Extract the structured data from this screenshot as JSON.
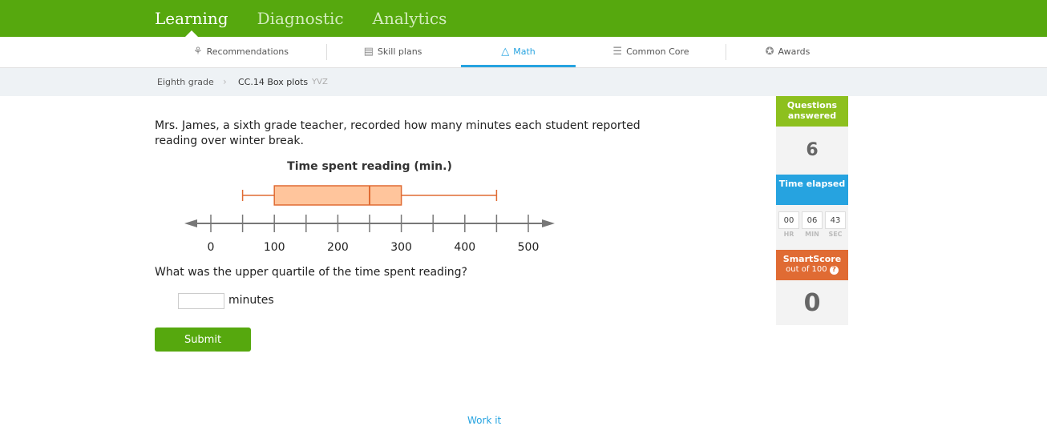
{
  "topnav": [
    "Learning",
    "Diagnostic",
    "Analytics"
  ],
  "subnav": {
    "items": [
      {
        "label": "Recommendations",
        "icon": "recommendations-icon"
      },
      {
        "label": "Skill plans",
        "icon": "skill-plans-icon"
      },
      {
        "label": "Math",
        "icon": "math-icon"
      },
      {
        "label": "Common Core",
        "icon": "common-core-icon"
      },
      {
        "label": "Awards",
        "icon": "awards-icon"
      }
    ],
    "active": "Math"
  },
  "breadcrumb": {
    "grade": "Eighth grade",
    "skill": "CC.14 Box plots",
    "code": "YVZ"
  },
  "question": {
    "text": "Mrs. James, a sixth grade teacher, recorded how many minutes each student reported reading over winter break.",
    "ask": "What was the upper quartile of the time spent reading?",
    "unit": "minutes",
    "submit_label": "Submit"
  },
  "chart_data": {
    "type": "box",
    "title": "Time spent reading (min.)",
    "min": 50,
    "q1": 100,
    "median": 250,
    "q3": 300,
    "max": 450,
    "axis_range": [
      0,
      500
    ],
    "tick_step": 50,
    "tick_labels": [
      "0",
      "100",
      "200",
      "300",
      "400",
      "500"
    ]
  },
  "sidebar": {
    "questions_label": "Questions answered",
    "questions_value": "6",
    "time_label": "Time elapsed",
    "timer": [
      {
        "value": "00",
        "unit": "HR"
      },
      {
        "value": "06",
        "unit": "MIN"
      },
      {
        "value": "43",
        "unit": "SEC"
      }
    ],
    "smartscore_label": "SmartScore",
    "smartscore_sub": "out of 100",
    "smartscore_value": "0"
  },
  "colors": {
    "green": "#56a80e",
    "blue": "#26a3e0",
    "orange": "#e06b33",
    "box_fill": "#ffc59c"
  }
}
